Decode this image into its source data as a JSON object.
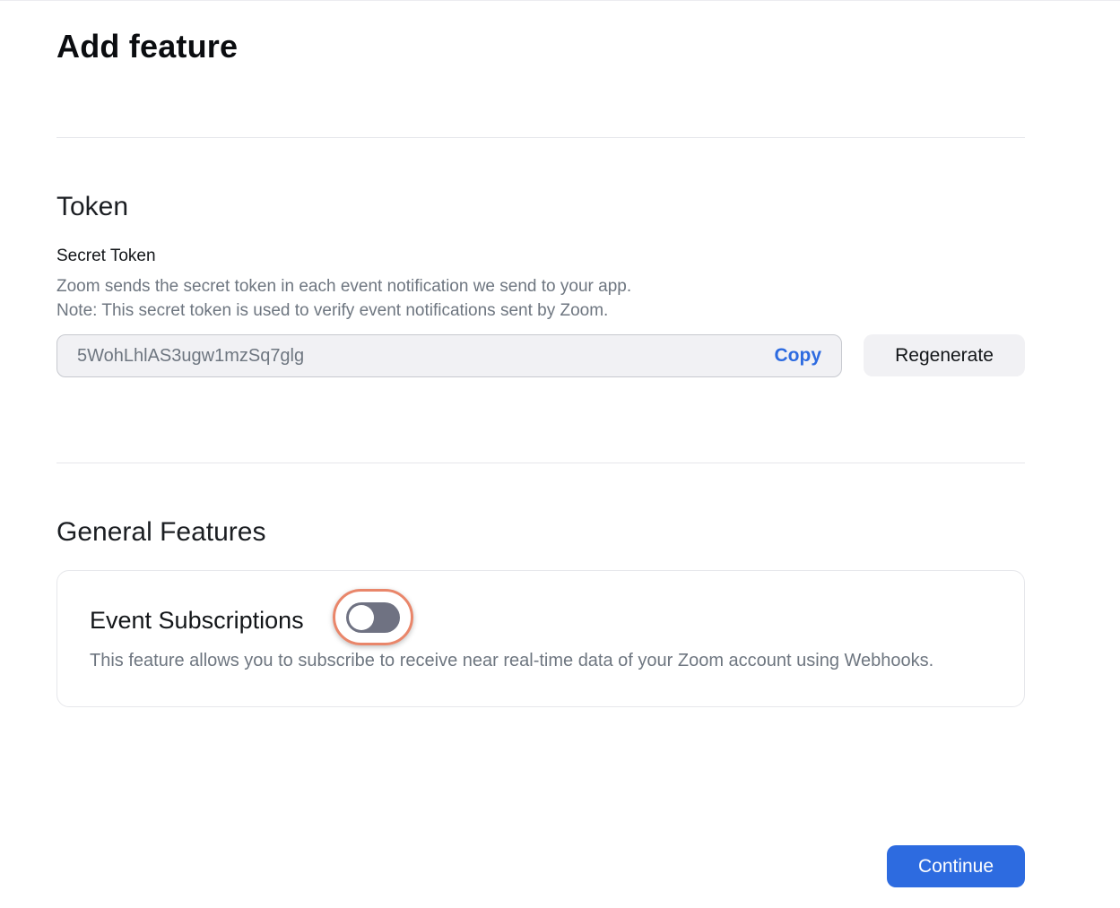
{
  "page": {
    "title": "Add feature"
  },
  "token_section": {
    "title": "Token",
    "field_label": "Secret Token",
    "help_line_1": "Zoom sends the secret token in each event notification we send to your app.",
    "help_line_2": "Note: This secret token is used to verify event notifications sent by Zoom.",
    "token_value": "5WohLhlAS3ugw1mzSq7glg",
    "copy_label": "Copy",
    "regenerate_label": "Regenerate"
  },
  "general_section": {
    "title": "General Features",
    "feature": {
      "name": "Event Subscriptions",
      "enabled": false,
      "description": "This feature allows you to subscribe to receive near real-time data of your Zoom account using Webhooks."
    }
  },
  "footer": {
    "continue_label": "Continue"
  },
  "colors": {
    "accent": "#2d6be0",
    "toggle_off": "#6f7282",
    "highlight_ring": "#e9866a"
  }
}
